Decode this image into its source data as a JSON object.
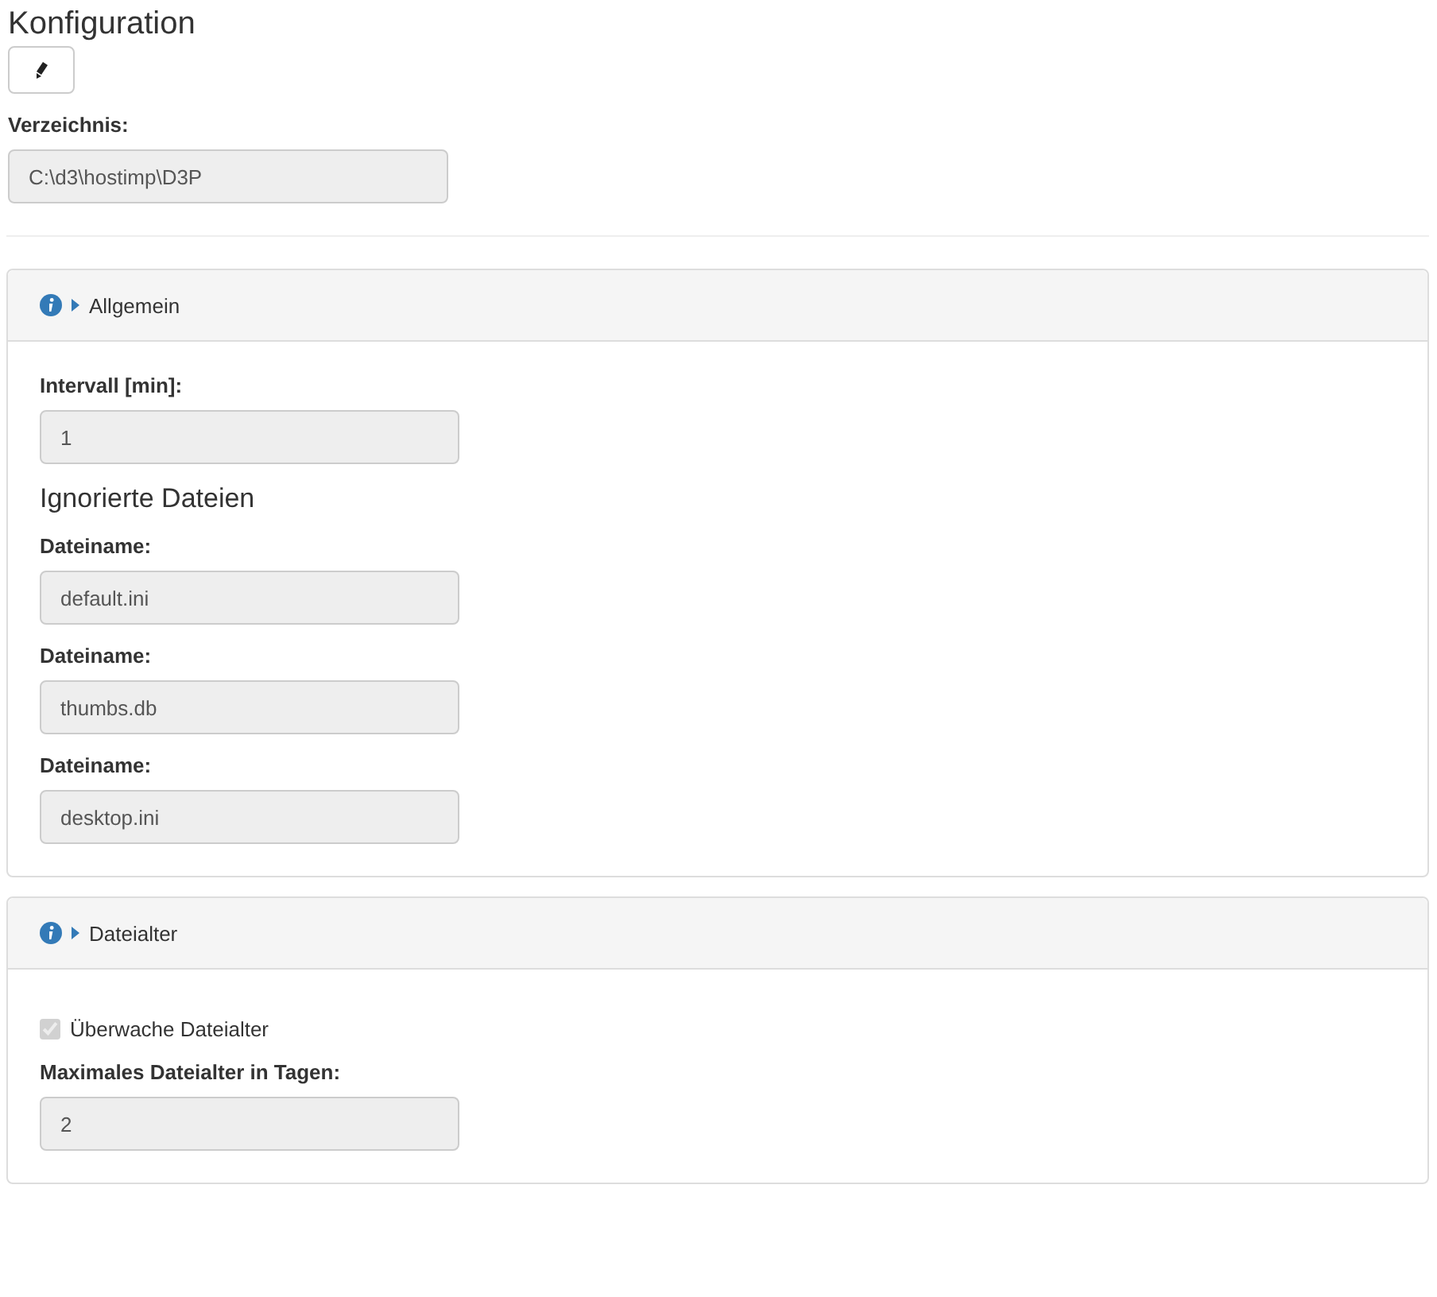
{
  "title": "Konfiguration",
  "edit_button": {
    "disabled": false
  },
  "directory": {
    "label": "Verzeichnis:",
    "value": "C:\\d3\\hostimp\\D3P",
    "disabled": true
  },
  "panels": [
    {
      "title": "Allgemein",
      "items": [
        {
          "kind": "field",
          "label": "Intervall [min]:",
          "value": "1",
          "disabled": true
        },
        {
          "kind": "heading",
          "text": "Ignorierte Dateien"
        },
        {
          "kind": "field",
          "label": "Dateiname:",
          "value": "default.ini",
          "disabled": true
        },
        {
          "kind": "field",
          "label": "Dateiname:",
          "value": "thumbs.db",
          "disabled": true
        },
        {
          "kind": "field",
          "label": "Dateiname:",
          "value": "desktop.ini",
          "disabled": true
        }
      ]
    },
    {
      "title": "Dateialter",
      "items": [
        {
          "kind": "checkbox",
          "label": "Überwache Dateialter",
          "checked": true,
          "disabled": true
        },
        {
          "kind": "field",
          "label": "Maximales Dateialter in Tagen:",
          "value": "2",
          "disabled": true
        }
      ]
    }
  ]
}
